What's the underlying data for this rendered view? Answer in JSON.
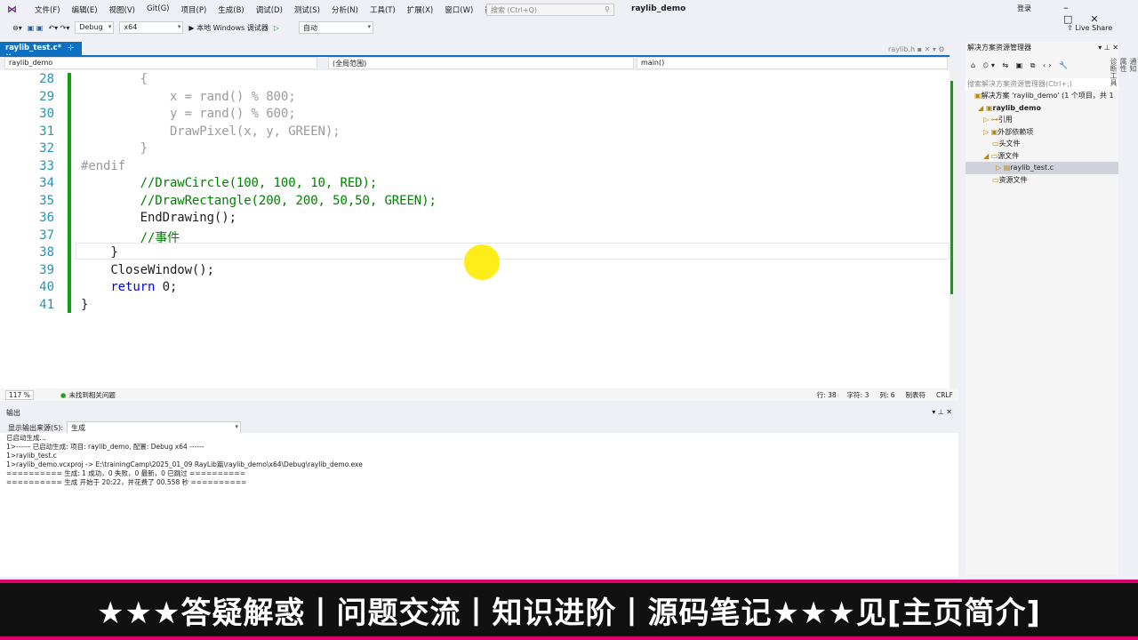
{
  "menu": [
    "文件(F)",
    "编辑(E)",
    "视图(V)",
    "Git(G)",
    "项目(P)",
    "生成(B)",
    "调试(D)",
    "测试(S)",
    "分析(N)",
    "工具(T)",
    "扩展(X)",
    "窗口(W)",
    "帮助(H)"
  ],
  "search_placeholder": "搜索 (Ctrl+Q)",
  "window_title": "raylib_demo",
  "login": "登录",
  "live_share": "Live Share",
  "toolbar": {
    "config": "Debug",
    "platform": "x64",
    "run": "▶ 本地 Windows 调试器",
    "auto": "自动"
  },
  "tab": {
    "active": "raylib_test.c*",
    "other": "raylib.h"
  },
  "nav": {
    "project": "raylib_demo",
    "scope": "(全局范围)",
    "func": "main()"
  },
  "code": [
    {
      "n": "28",
      "t": "        {",
      "c": "grey"
    },
    {
      "n": "29",
      "t": "            x = rand() % 800;",
      "c": "grey"
    },
    {
      "n": "30",
      "t": "            y = rand() % 600;",
      "c": "grey"
    },
    {
      "n": "31",
      "t": "            DrawPixel(x, y, GREEN);",
      "c": "grey"
    },
    {
      "n": "32",
      "t": "        }",
      "c": "grey"
    },
    {
      "n": "33",
      "t": "#endif",
      "c": "grey"
    },
    {
      "n": "34",
      "t": "        //DrawCircle(100, 100, 10, RED);",
      "c": "green"
    },
    {
      "n": "35",
      "t": "        //DrawRectangle(200, 200, 50,50, GREEN);",
      "c": "green"
    },
    {
      "n": "36",
      "t": "        EndDrawing();",
      "c": "dark"
    },
    {
      "n": "37",
      "t": "        //事件",
      "c": "green"
    },
    {
      "n": "38",
      "t": "    }",
      "c": "dark"
    },
    {
      "n": "39",
      "t": "    CloseWindow();",
      "c": "dark"
    },
    {
      "n": "40",
      "t": "    return 0;",
      "c": "dark"
    },
    {
      "n": "41",
      "t": "}",
      "c": "dark"
    }
  ],
  "status": {
    "zoom": "117 %",
    "issues": "未找到相关问题",
    "line": "行: 38",
    "char": "字符: 3",
    "col": "列: 6",
    "tabs": "制表符",
    "eol": "CRLF"
  },
  "output": {
    "title": "输出",
    "source_label": "显示输出来源(S):",
    "source": "生成",
    "lines": [
      "已启动生成…",
      "1>------ 已启动生成: 项目: raylib_demo, 配置: Debug x64 ------",
      "1>raylib_test.c",
      "1>raylib_demo.vcxproj -> E:\\trainingCamp\\2025_01_09 RayLib篇\\raylib_demo\\x64\\Debug\\raylib_demo.exe",
      "========== 生成: 1 成功，0 失败，0 最新，0 已跳过 ==========",
      "========== 生成 开始于 20:22，并花费了 00.558 秒 =========="
    ]
  },
  "solution": {
    "title": "解决方案资源管理器",
    "search": "搜索解决方案资源管理器(Ctrl+;)",
    "items": [
      "解决方案 'raylib_demo' (1 个项目，共 1",
      "raylib_demo",
      "引用",
      "外部依赖项",
      "头文件",
      "源文件",
      "raylib_test.c",
      "资源文件"
    ]
  },
  "side_tabs": [
    "通知",
    "属性",
    "诊断工具"
  ],
  "banner": "★★★答疑解惑丨问题交流丨知识进阶丨源码笔记★★★见[主页简介]"
}
